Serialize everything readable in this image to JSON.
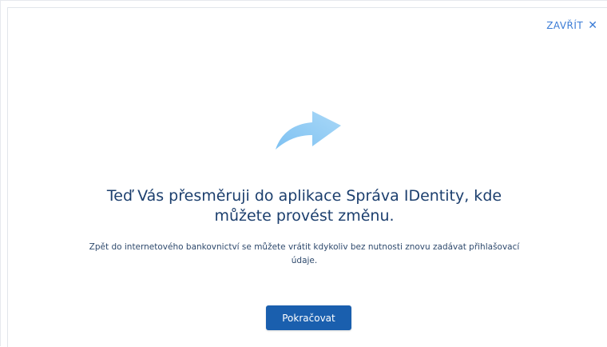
{
  "dialog": {
    "close_label": "ZAVŘÍT",
    "close_icon": "close-icon",
    "heading": "Teď Vás přesměruji do aplikace Správa IDentity, kde můžete provést změnu.",
    "subtext": "Zpět do internetového bankovnictví se můžete vrátit kdykoliv bez nutnosti znovu zadávat přihlašovací údaje.",
    "illustration_icon": "redirect-arrow-icon",
    "continue_label": "Pokračovat"
  },
  "colors": {
    "accent": "#3a7bd5",
    "primary_button": "#1a5fae",
    "heading_text": "#1c3f6e",
    "arrow_light": "#9fd0f5",
    "arrow_dark": "#6fb6ee"
  }
}
